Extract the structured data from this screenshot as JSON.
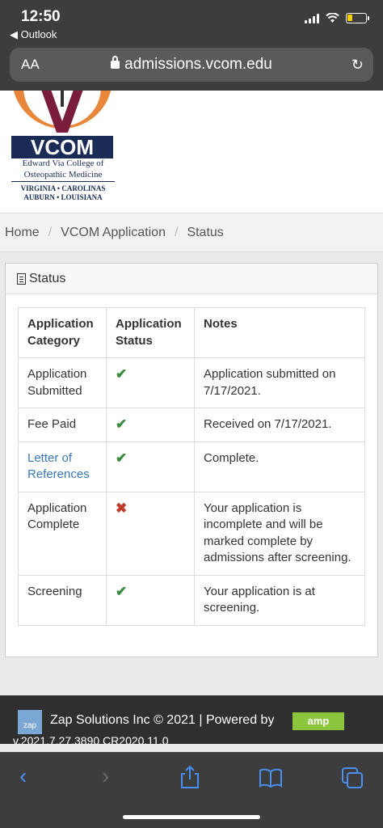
{
  "status_bar": {
    "time": "12:50",
    "back_app": "◀ Outlook"
  },
  "browser": {
    "text_size": "AA",
    "url": "admissions.vcom.edu"
  },
  "logo": {
    "name": "VCOM",
    "line1": "Edward Via College of",
    "line2": "Osteopathic Medicine",
    "line3": "VIRGINIA • CAROLINAS",
    "line4": "AUBURN • LOUISIANA"
  },
  "breadcrumb": {
    "home": "Home",
    "app": "VCOM Application",
    "current": "Status",
    "sep": "/"
  },
  "panel": {
    "title": "Status"
  },
  "table": {
    "headers": [
      "Application Category",
      "Application Status",
      "Notes"
    ],
    "rows": [
      {
        "category": "Application Submitted",
        "status": "✔",
        "notes": "Application submitted on 7/17/2021."
      },
      {
        "category": "Fee Paid",
        "status": "✔",
        "notes": "Received on 7/17/2021."
      },
      {
        "category": "Letter of References",
        "status": "✔",
        "notes": "Complete."
      },
      {
        "category": "Application Complete",
        "status": "✖",
        "notes": "Your application is incomplete and will be marked complete by admissions after screening."
      },
      {
        "category": "Screening",
        "status": "✔",
        "notes": "Your application is at screening."
      }
    ]
  },
  "footer": {
    "company": "Zap Solutions Inc © 2021 | Powered by",
    "zap": "zap",
    "amp": "amp",
    "version": "v.2021.7.27.3890 CR2020.11.0"
  },
  "colors": {
    "link": "#3a78b5",
    "check": "#3b8a3f",
    "cross": "#c0392b",
    "ios_blue": "#4a8ef0"
  }
}
